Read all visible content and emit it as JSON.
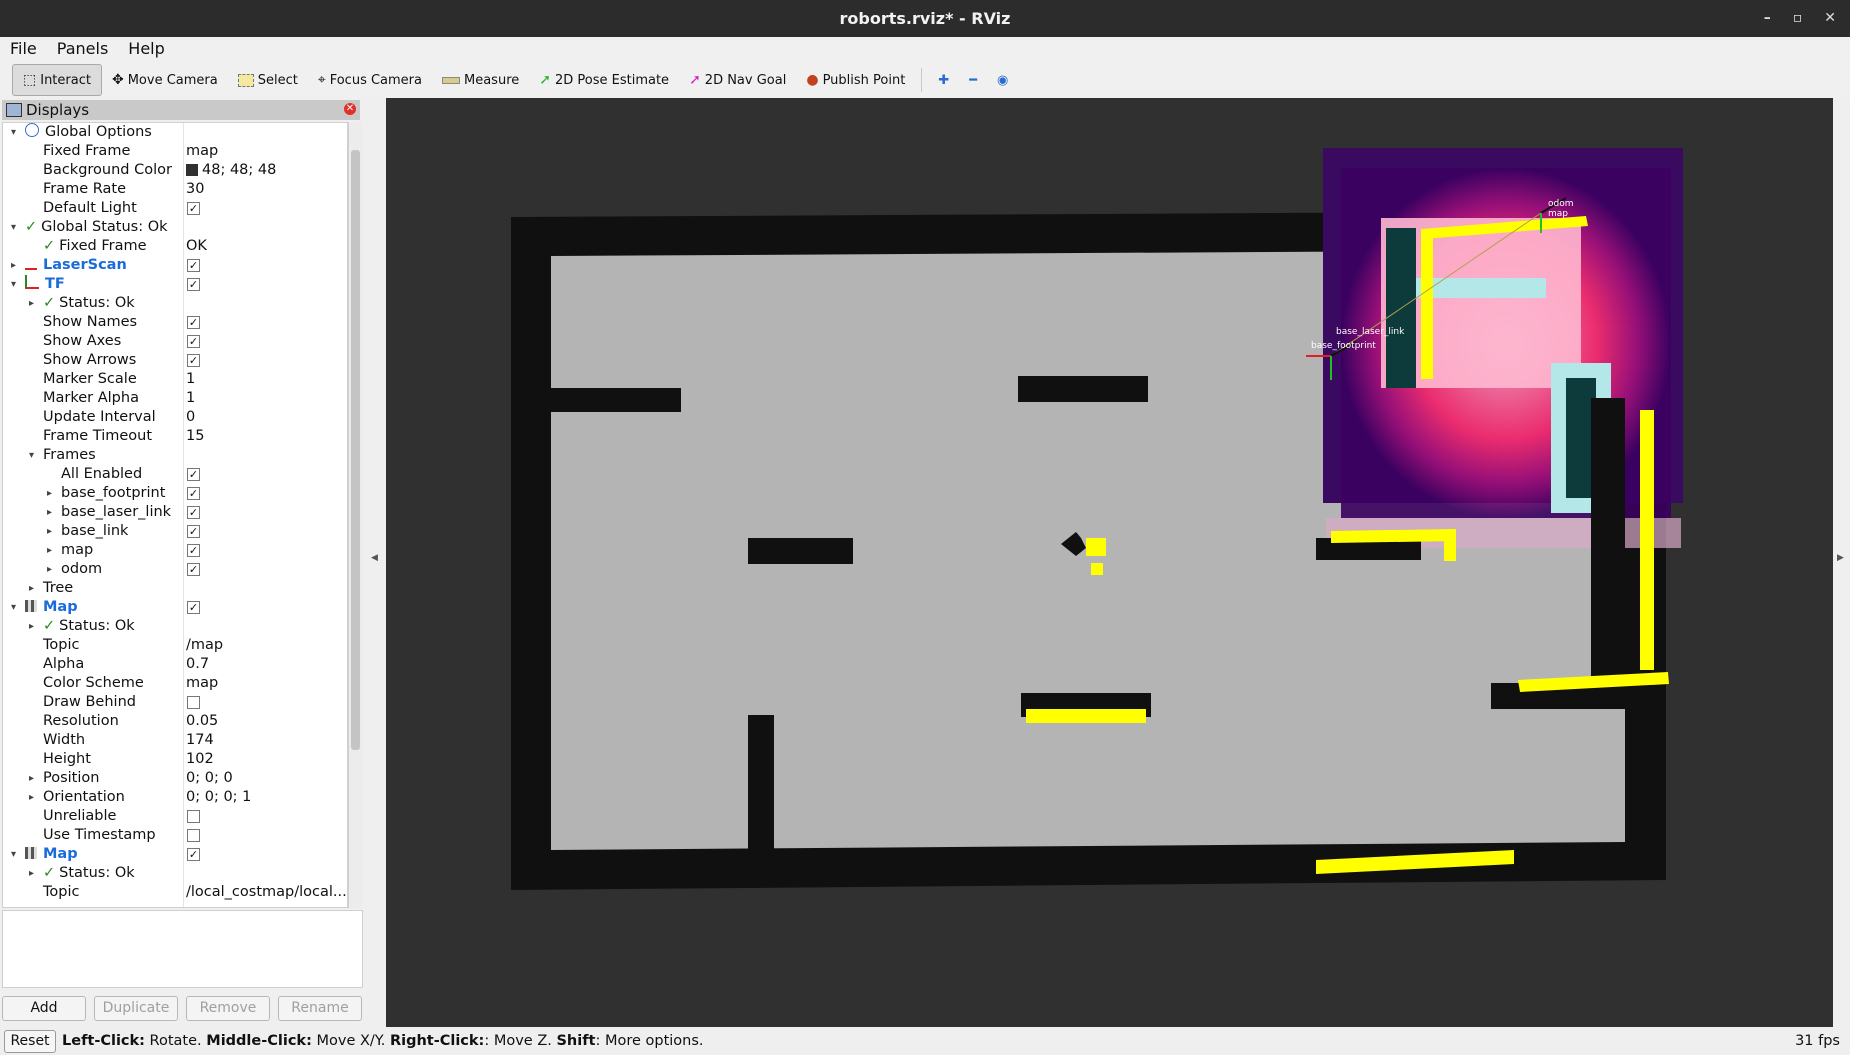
{
  "window": {
    "title": "roborts.rviz* - RViz"
  },
  "menu": [
    "File",
    "Panels",
    "Help"
  ],
  "toolbar": {
    "tools": [
      {
        "label": "Interact",
        "icon": "cursor-icon",
        "active": true
      },
      {
        "label": "Move Camera",
        "icon": "move-camera-icon"
      },
      {
        "label": "Select",
        "icon": "select-icon"
      },
      {
        "label": "Focus Camera",
        "icon": "focus-camera-icon"
      },
      {
        "label": "Measure",
        "icon": "measure-icon"
      },
      {
        "label": "2D Pose Estimate",
        "icon": "pose-estimate-arrow-icon"
      },
      {
        "label": "2D Nav Goal",
        "icon": "nav-goal-arrow-icon"
      },
      {
        "label": "Publish Point",
        "icon": "map-pin-icon"
      }
    ]
  },
  "displays": {
    "title": "Displays",
    "rows": [
      {
        "indent": 0,
        "arrow": "open",
        "label": "Global Options",
        "icon": "globe"
      },
      {
        "indent": 1,
        "label": "Fixed Frame",
        "value": "map"
      },
      {
        "indent": 1,
        "label": "Background Color",
        "value": "48; 48; 48",
        "swatch": "#303030"
      },
      {
        "indent": 1,
        "label": "Frame Rate",
        "value": "30"
      },
      {
        "indent": 1,
        "label": "Default Light",
        "check": true
      },
      {
        "indent": 0,
        "arrow": "open",
        "label": "Global Status: Ok",
        "ok": true
      },
      {
        "indent": 1,
        "label": "Fixed Frame",
        "value": "OK",
        "ok": true
      },
      {
        "indent": 0,
        "arrow": "closed",
        "label": "LaserScan",
        "blue": true,
        "icon": "laser",
        "check": true
      },
      {
        "indent": 0,
        "arrow": "open",
        "label": "TF",
        "blue": true,
        "icon": "tf",
        "check": true
      },
      {
        "indent": 1,
        "arrow": "closed",
        "label": "Status: Ok",
        "ok": true
      },
      {
        "indent": 1,
        "label": "Show Names",
        "check": true
      },
      {
        "indent": 1,
        "label": "Show Axes",
        "check": true
      },
      {
        "indent": 1,
        "label": "Show Arrows",
        "check": true
      },
      {
        "indent": 1,
        "label": "Marker Scale",
        "value": "1"
      },
      {
        "indent": 1,
        "label": "Marker Alpha",
        "value": "1"
      },
      {
        "indent": 1,
        "label": "Update Interval",
        "value": "0"
      },
      {
        "indent": 1,
        "label": "Frame Timeout",
        "value": "15"
      },
      {
        "indent": 1,
        "arrow": "open",
        "label": "Frames"
      },
      {
        "indent": 2,
        "label": "All Enabled",
        "check": true
      },
      {
        "indent": 2,
        "arrow": "closed",
        "label": "base_footprint",
        "check": true
      },
      {
        "indent": 2,
        "arrow": "closed",
        "label": "base_laser_link",
        "check": true
      },
      {
        "indent": 2,
        "arrow": "closed",
        "label": "base_link",
        "check": true
      },
      {
        "indent": 2,
        "arrow": "closed",
        "label": "map",
        "check": true
      },
      {
        "indent": 2,
        "arrow": "closed",
        "label": "odom",
        "check": true
      },
      {
        "indent": 1,
        "arrow": "closed",
        "label": "Tree"
      },
      {
        "indent": 0,
        "arrow": "open",
        "label": "Map",
        "blue": true,
        "icon": "map",
        "check": true
      },
      {
        "indent": 1,
        "arrow": "closed",
        "label": "Status: Ok",
        "ok": true
      },
      {
        "indent": 1,
        "label": "Topic",
        "value": "/map"
      },
      {
        "indent": 1,
        "label": "Alpha",
        "value": "0.7"
      },
      {
        "indent": 1,
        "label": "Color Scheme",
        "value": "map"
      },
      {
        "indent": 1,
        "label": "Draw Behind",
        "check": false
      },
      {
        "indent": 1,
        "label": "Resolution",
        "value": "0.05"
      },
      {
        "indent": 1,
        "label": "Width",
        "value": "174"
      },
      {
        "indent": 1,
        "label": "Height",
        "value": "102"
      },
      {
        "indent": 1,
        "arrow": "closed",
        "label": "Position",
        "value": "0; 0; 0"
      },
      {
        "indent": 1,
        "arrow": "closed",
        "label": "Orientation",
        "value": "0; 0; 0; 1"
      },
      {
        "indent": 1,
        "label": "Unreliable",
        "check": false
      },
      {
        "indent": 1,
        "label": "Use Timestamp",
        "check": false
      },
      {
        "indent": 0,
        "arrow": "open",
        "label": "Map",
        "blue": true,
        "icon": "map",
        "check": true
      },
      {
        "indent": 1,
        "arrow": "closed",
        "label": "Status: Ok",
        "ok": true
      },
      {
        "indent": 1,
        "label": "Topic",
        "value": "/local_costmap/local..."
      }
    ]
  },
  "buttons": {
    "add": "Add",
    "duplicate": "Duplicate",
    "remove": "Remove",
    "rename": "Rename"
  },
  "view3d": {
    "frame_labels": [
      "map",
      "odom",
      "base_laser_link",
      "base_footprint"
    ],
    "background": "#303030"
  },
  "status": {
    "reset": "Reset",
    "hint_parts": [
      {
        "b": "Left-Click:",
        "t": " Rotate. "
      },
      {
        "b": "Middle-Click:",
        "t": " Move X/Y. "
      },
      {
        "b": "Right-Click:",
        "t": ": Move Z. "
      },
      {
        "b": "Shift",
        "t": ": More options."
      }
    ],
    "fps": "31 fps"
  }
}
